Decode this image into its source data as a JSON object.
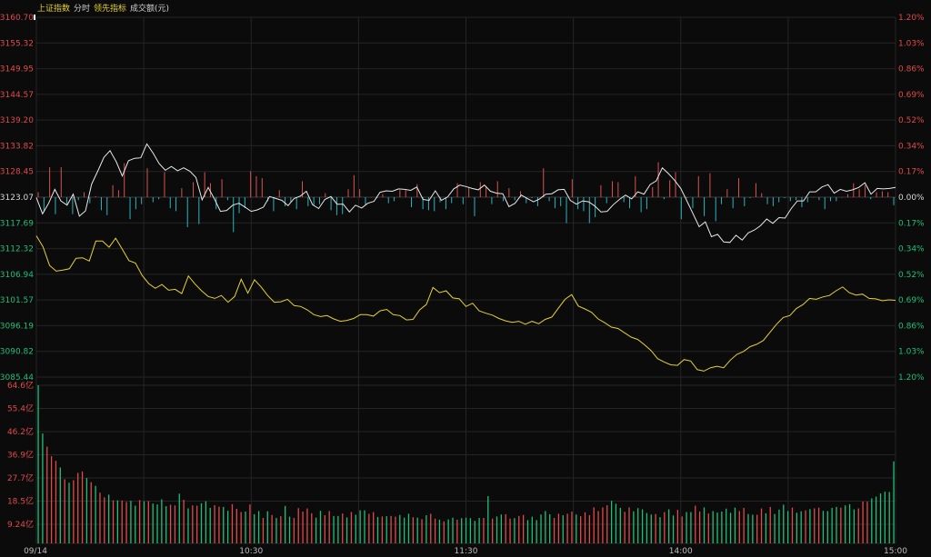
{
  "header": {
    "index_name": "上证指数",
    "mode": "分时",
    "indicator": "领先指标",
    "volume_label": "成交额(元)"
  },
  "colors": {
    "background": "#0b0b0b",
    "grid": "#252525",
    "up": "#e04a4a",
    "down": "#1fbf7a",
    "neutral": "#d8d8d8",
    "price_line": "#e8e8e8",
    "lead_line": "#e5d12f",
    "header_active": "#e5d12f",
    "header_text": "#cfcfcf",
    "bar_up": "#d9534f",
    "bar_down": "#2bb3c0"
  },
  "chart_data": [
    {
      "type": "line",
      "title": "",
      "prev_close": 3123.07,
      "y_left_ticks": [
        "3160.70",
        "3155.32",
        "3149.95",
        "3144.57",
        "3139.20",
        "3133.82",
        "3128.45",
        "3123.07",
        "3117.69",
        "3112.32",
        "3106.94",
        "3101.57",
        "3096.19",
        "3090.82",
        "3085.44"
      ],
      "y_right_ticks": [
        "1.20%",
        "1.03%",
        "0.86%",
        "0.69%",
        "0.52%",
        "0.34%",
        "0.17%",
        "0.00%",
        "0.17%",
        "0.34%",
        "0.52%",
        "0.69%",
        "0.86%",
        "1.03%",
        "1.20%"
      ],
      "ylim": [
        3085.44,
        3160.7
      ],
      "x_labels": [
        "09/14",
        "10:30",
        "11:30",
        "14:00",
        "15:00"
      ],
      "series": [
        {
          "kind": "price",
          "values": [
            3123.0,
            3119.6,
            3121.8,
            3124.7,
            3122.3,
            3121.4,
            3123.7,
            3119.1,
            3120.2,
            3125.8,
            3128.5,
            3131.4,
            3132.8,
            3130.5,
            3127.5,
            3130.7,
            3131.2,
            3131.3,
            3134.2,
            3132.3,
            3130.1,
            3128.7,
            3129.5,
            3128.6,
            3129.2,
            3128.5,
            3127.2,
            3122.5,
            3125.1,
            3122.7,
            3120.1,
            3120.3,
            3121.4,
            3121.8,
            3121.0,
            3120.1,
            3120.4,
            3121.0,
            3123.2,
            3122.8,
            3122.4,
            3121.3,
            3122.8,
            3123.3,
            3124.3,
            3121.5,
            3120.7,
            3122.6,
            3123.2,
            3121.6,
            3121.6,
            3120.0,
            3121.4,
            3120.8,
            3121.8,
            3122.2,
            3124.1,
            3124.4,
            3124.3,
            3124.8,
            3124.7,
            3124.5,
            3125.2,
            3122.6,
            3122.4,
            3124.4,
            3122.4,
            3123.1,
            3124.8,
            3125.6,
            3125.3,
            3124.9,
            3124.6,
            3125.6,
            3124.3,
            3123.9,
            3123.8,
            3121.1,
            3121.8,
            3123.5,
            3122.8,
            3122.1,
            3122.7,
            3123.7,
            3123.8,
            3124.6,
            3124.7,
            3122.4,
            3121.6,
            3122.3,
            3122.1,
            3121.2,
            3120.0,
            3120.1,
            3121.5,
            3122.6,
            3123.5,
            3122.7,
            3124.2,
            3123.7,
            3125.7,
            3126.5,
            3129.2,
            3128.0,
            3126.6,
            3124.9,
            3122.3,
            3119.6,
            3116.9,
            3117.9,
            3114.8,
            3115.3,
            3113.7,
            3113.6,
            3115.1,
            3114.1,
            3115.6,
            3116.2,
            3117.1,
            3118.5,
            3117.6,
            3118.8,
            3118.7,
            3120.7,
            3122.3,
            3122.3,
            3124.2,
            3124.2,
            3125.2,
            3125.7,
            3123.9,
            3124.7,
            3124.3,
            3124.6,
            3125.1,
            3126.1,
            3123.7,
            3124.9,
            3124.8,
            3124.9,
            3125.1
          ]
        },
        {
          "kind": "leading",
          "values": [
            3115.0,
            3112.7,
            3108.8,
            3107.6,
            3107.8,
            3108.1,
            3110.3,
            3110.4,
            3109.7,
            3113.9,
            3113.9,
            3112.6,
            3114.5,
            3112.2,
            3109.8,
            3109.3,
            3106.7,
            3105.0,
            3104.0,
            3104.8,
            3103.6,
            3103.8,
            3102.9,
            3106.6,
            3104.9,
            3103.5,
            3102.3,
            3101.9,
            3102.5,
            3101.1,
            3102.3,
            3105.9,
            3103.0,
            3105.8,
            3104.3,
            3102.5,
            3101.1,
            3101.2,
            3101.7,
            3100.4,
            3100.2,
            3099.5,
            3098.5,
            3098.1,
            3098.3,
            3097.6,
            3097.1,
            3097.3,
            3097.7,
            3098.5,
            3098.5,
            3098.2,
            3099.3,
            3099.6,
            3098.5,
            3098.3,
            3097.4,
            3097.5,
            3099.5,
            3100.6,
            3104.2,
            3103.1,
            3103.5,
            3102.0,
            3101.8,
            3100.2,
            3100.9,
            3099.3,
            3098.8,
            3098.4,
            3097.7,
            3097.2,
            3096.9,
            3097.1,
            3096.5,
            3097.1,
            3096.6,
            3097.5,
            3098.0,
            3099.9,
            3101.7,
            3102.7,
            3100.3,
            3099.7,
            3099.0,
            3097.6,
            3096.8,
            3095.9,
            3095.6,
            3094.7,
            3093.8,
            3093.3,
            3092.2,
            3091.0,
            3089.3,
            3088.6,
            3088.0,
            3087.9,
            3089.1,
            3088.8,
            3087.0,
            3086.7,
            3087.4,
            3087.7,
            3087.4,
            3089.0,
            3090.2,
            3090.8,
            3091.8,
            3092.3,
            3093.1,
            3094.8,
            3096.5,
            3097.9,
            3098.3,
            3099.8,
            3100.6,
            3101.9,
            3101.7,
            3102.2,
            3102.5,
            3103.5,
            3104.3,
            3103.1,
            3102.6,
            3102.8,
            3101.9,
            3101.8,
            3101.4,
            3101.6,
            3101.5
          ]
        }
      ],
      "change_bars": [
        0.5,
        -1.5,
        3.0,
        -1.7,
        3.0,
        -0.7,
        -1.7,
        -0.3,
        0.5,
        -0.6,
        0.1,
        -1.3,
        -1.8,
        1.2,
        0.7,
        3.4,
        -2.2,
        -1.2,
        -0.7,
        2.9,
        -0.5,
        -0.2,
        2.5,
        -1.1,
        -1.4,
        0.9,
        -3.0,
        1.5,
        -2.7,
        2.5,
        1.4,
        -1.2,
        1.8,
        -0.3,
        -3.5,
        -1.6,
        -1.1,
        2.6,
        2.1,
        1.9,
        -0.4,
        -1.4,
        0.7,
        -0.9,
        -0.5,
        -1.2,
        1.6,
        -0.9,
        -0.8,
        -0.7,
        0.4,
        -1.3,
        -1.8,
        -1.7,
        0.8,
        2.2,
        0.8,
        -0.8,
        0.0,
        -0.1,
        0.3,
        -0.6,
        -0.4,
        0.7,
        0.7,
        -1.0,
        1.3,
        -1.2,
        -1.3,
        -1.4,
        -0.5,
        -1.2,
        -0.6,
        1.4,
        -0.7,
        1.0,
        -1.9,
        1.5,
        1.1,
        -0.7,
        1.6,
        -0.4,
        0.9,
        -0.3,
        0.6,
        -0.6,
        -0.1,
        -0.9,
        2.9,
        -0.4,
        -1.1,
        -0.9,
        -2.6,
        1.8,
        -1.2,
        -1.4,
        -2.6,
        -2.0,
        1.2,
        -0.6,
        1.6,
        1.5,
        -0.5,
        -1.1,
        2.1,
        -1.5,
        -1.2,
        1.0,
        3.5,
        -0.2,
        1.7,
        2.5,
        -2.2,
        -0.1,
        -1.1,
        2.1,
        -1.9,
        2.4,
        -2.4,
        -0.7,
        0.8,
        -1.1,
        1.9,
        -0.9,
        -0.1,
        1.4,
        0.4,
        -0.7,
        -0.9,
        -0.5,
        -0.1,
        -0.4,
        -0.3,
        -1.0,
        -0.5,
        0.0,
        -0.3,
        -1.2,
        -0.4,
        -0.4,
        0.0,
        0.3,
        1.4,
        0.8,
        1.2,
        -0.2,
        0.5,
        0.6,
        0.5,
        -0.8
      ]
    },
    {
      "type": "bar",
      "title": "",
      "y_ticks": [
        "64.6亿",
        "55.4亿",
        "46.2亿",
        "36.9亿",
        "27.7亿",
        "18.5亿",
        "9.24亿"
      ],
      "ylim": [
        0,
        64.6
      ],
      "values": [
        64.6,
        44.9,
        39.5,
        35.6,
        33.7,
        31.0,
        26.2,
        24.8,
        25.8,
        28.8,
        29.4,
        26.7,
        25.0,
        23.5,
        20.7,
        18.8,
        19.9,
        17.6,
        17.6,
        17.5,
        16.9,
        17.4,
        15.4,
        17.7,
        17.2,
        17.3,
        16.3,
        15.9,
        18.0,
        15.2,
        15.8,
        15.5,
        20.3,
        17.8,
        14.3,
        15.5,
        15.4,
        16.4,
        17.2,
        14.5,
        15.6,
        15.0,
        14.9,
        13.3,
        16.0,
        14.1,
        12.8,
        13.0,
        15.9,
        11.9,
        13.2,
        10.4,
        13.1,
        11.6,
        10.4,
        11.1,
        15.3,
        10.9,
        10.4,
        14.4,
        13.0,
        14.3,
        12.3,
        10.5,
        13.3,
        11.5,
        13.2,
        11.2,
        11.2,
        12.2,
        10.6,
        12.8,
        11.7,
        13.5,
        13.5,
        12.1,
        12.8,
        10.8,
        11.0,
        11.1,
        11.2,
        10.9,
        11.6,
        10.5,
        12.1,
        10.7,
        10.5,
        9.9,
        11.5,
        12.1,
        10.1,
        9.7,
        9.0,
        9.8,
        10.5,
        9.7,
        10.3,
        10.5,
        10.3,
        9.2,
        10.4,
        10.4,
        19.3,
        10.1,
        11.0,
        11.8,
        11.9,
        10.1,
        10.3,
        11.2,
        11.6,
        9.5,
        10.9,
        9.5,
        11.8,
        13.2,
        11.9,
        10.4,
        12.1,
        11.5,
        12.1,
        13.0,
        11.8,
        11.1,
        12.7,
        11.5,
        14.7,
        13.2,
        14.7,
        15.6,
        17.4,
        16.2,
        14.5,
        12.9,
        14.7,
        13.1,
        14.4,
        13.9,
        12.4,
        11.8,
        12.0,
        10.7,
        12.8,
        13.9,
        11.4,
        13.7,
        11.0,
        12.8,
        12.8,
        15.4,
        13.0,
        14.7,
        12.2,
        13.2,
        12.6,
        13.0,
        14.2,
        12.5,
        14.6,
        13.2,
        14.5,
        12.0,
        11.7,
        11.7,
        14.3,
        12.3,
        14.9,
        12.0,
        13.8,
        15.8,
        13.2,
        14.6,
        12.5,
        13.1,
        13.5,
        14.0,
        14.3,
        14.6,
        13.3,
        13.2,
        14.5,
        14.9,
        14.6,
        15.5,
        16.0,
        13.9,
        14.3,
        17.1,
        17.0,
        18.4,
        19.1,
        20.4,
        21.1,
        21.0,
        33.5
      ],
      "directions": [
        "D",
        "D",
        "U",
        "U",
        "U",
        "D",
        "U",
        "D",
        "U",
        "U",
        "U",
        "D",
        "U",
        "D",
        "U",
        "U",
        "D",
        "U",
        "D",
        "U",
        "U",
        "D",
        "D",
        "U",
        "D",
        "U",
        "D",
        "D",
        "D",
        "D",
        "U",
        "U",
        "D",
        "U",
        "D",
        "U",
        "U",
        "D",
        "D",
        "D",
        "U",
        "U",
        "D",
        "D",
        "U",
        "U",
        "U",
        "D",
        "U",
        "D",
        "D",
        "U",
        "D",
        "U",
        "D",
        "U",
        "D",
        "D",
        "U",
        "U",
        "U",
        "U",
        "U",
        "D",
        "D",
        "U",
        "U",
        "D",
        "D",
        "U",
        "D",
        "U",
        "D",
        "D",
        "D",
        "U",
        "U",
        "D",
        "U",
        "D",
        "U",
        "U",
        "D",
        "D",
        "D",
        "U",
        "D",
        "U",
        "D",
        "U",
        "U",
        "D",
        "U",
        "D",
        "D",
        "U",
        "D",
        "D",
        "D",
        "D",
        "D",
        "U",
        "D",
        "U",
        "D",
        "D",
        "U",
        "U",
        "D",
        "U",
        "U",
        "D",
        "D",
        "D",
        "D",
        "D",
        "D",
        "U",
        "U",
        "D",
        "U",
        "U",
        "D",
        "U",
        "U",
        "U",
        "U",
        "U",
        "U",
        "U",
        "D",
        "D",
        "D",
        "U",
        "U",
        "D",
        "D",
        "D",
        "D",
        "D",
        "U",
        "D",
        "U",
        "D",
        "D",
        "U",
        "U",
        "D",
        "D",
        "U",
        "U",
        "D",
        "U",
        "D",
        "D",
        "D",
        "D",
        "D",
        "D",
        "U",
        "U",
        "D",
        "D",
        "U",
        "U",
        "D",
        "U",
        "D",
        "D",
        "D",
        "D",
        "U",
        "D",
        "D",
        "U",
        "D",
        "U",
        "U",
        "D",
        "D",
        "D",
        "D",
        "U",
        "D",
        "D",
        "D",
        "U",
        "U",
        "U"
      ]
    }
  ]
}
